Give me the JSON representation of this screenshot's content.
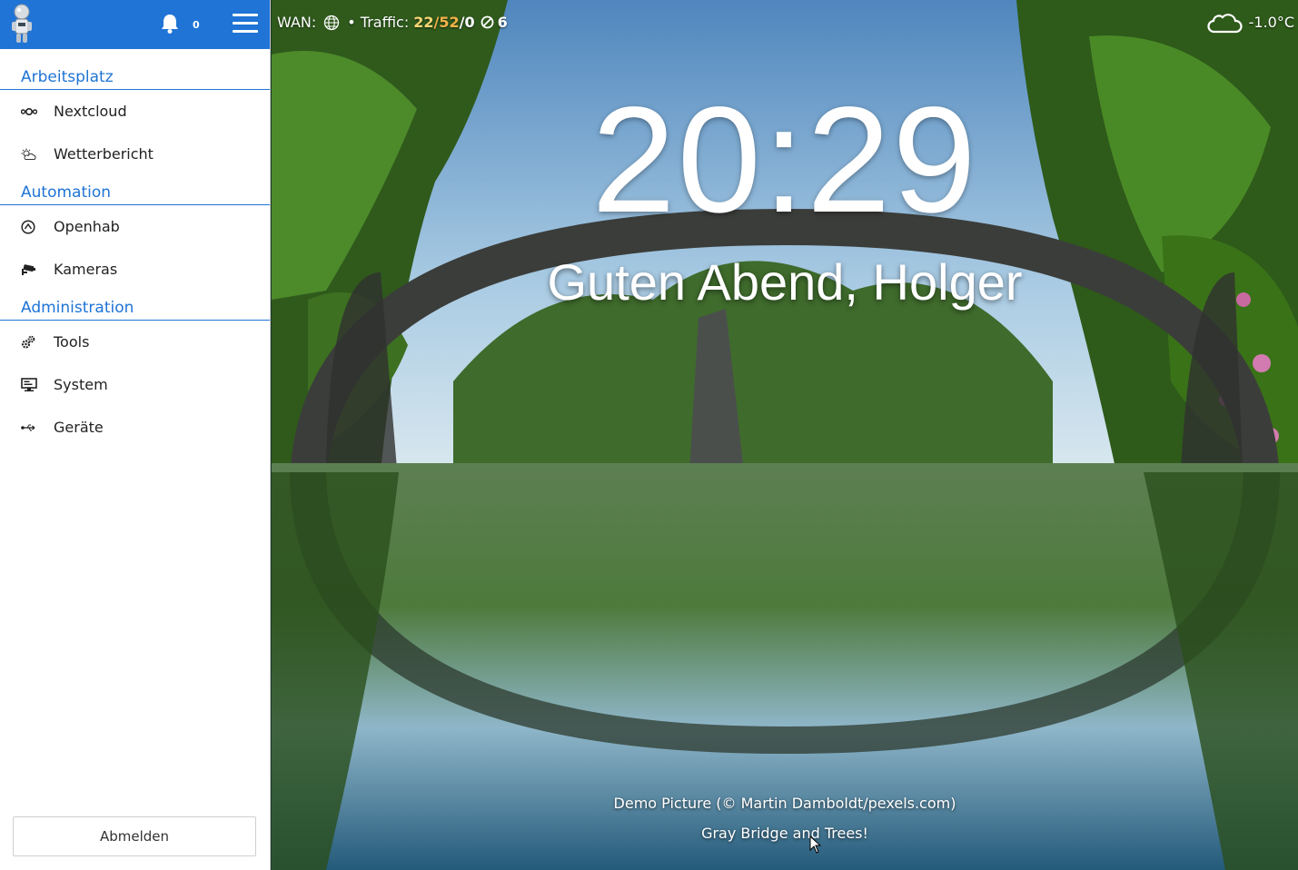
{
  "header": {
    "notification_count": "0"
  },
  "sidebar": {
    "groups": [
      {
        "title": "Arbeitsplatz",
        "items": [
          {
            "label": "Nextcloud",
            "icon": "nextcloud-icon"
          },
          {
            "label": "Wetterbericht",
            "icon": "weather-icon"
          }
        ]
      },
      {
        "title": "Automation",
        "items": [
          {
            "label": "Openhab",
            "icon": "openhab-icon"
          },
          {
            "label": "Kameras",
            "icon": "camera-icon"
          }
        ]
      },
      {
        "title": "Administration",
        "items": [
          {
            "label": "Tools",
            "icon": "gears-icon"
          },
          {
            "label": "System",
            "icon": "monitor-icon"
          },
          {
            "label": "Geräte",
            "icon": "usb-icon"
          }
        ]
      }
    ],
    "logout_label": "Abmelden"
  },
  "status": {
    "wan_label": "WAN:",
    "traffic_label": "• Traffic:",
    "traffic_in": "22",
    "traffic_out": "52",
    "traffic_err": "0",
    "blocked_count": "6"
  },
  "weather": {
    "temperature": "-1.0°C",
    "icon": "cloud-icon"
  },
  "clock": {
    "time": "20:29"
  },
  "greeting": "Guten Abend, Holger",
  "background": {
    "credit": "Demo Picture (© Martin Damboldt/pexels.com)",
    "title": "Gray Bridge and Trees!"
  },
  "colors": {
    "accent": "#1f74d6",
    "traffic_in": "#f7d774",
    "traffic_out": "#f5b24a"
  }
}
